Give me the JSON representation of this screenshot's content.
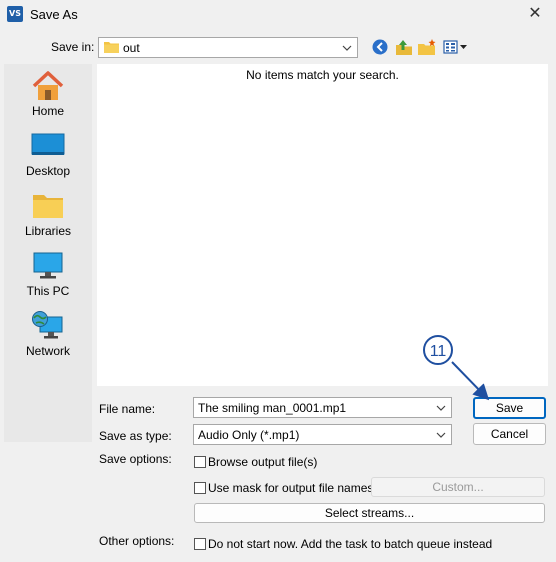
{
  "window": {
    "icon_text": "VS",
    "title": "Save As",
    "close_glyph": "✕"
  },
  "save_in": {
    "label": "Save in:",
    "value": "out"
  },
  "toolbar": {
    "icons": [
      "back-icon",
      "up-folder-icon",
      "new-folder-icon",
      "view-menu-icon"
    ]
  },
  "places": [
    {
      "label": "Home",
      "icon": "home-icon"
    },
    {
      "label": "Desktop",
      "icon": "desktop-icon"
    },
    {
      "label": "Libraries",
      "icon": "libraries-icon"
    },
    {
      "label": "This PC",
      "icon": "this-pc-icon"
    },
    {
      "label": "Network",
      "icon": "network-icon"
    }
  ],
  "file_list": {
    "empty_message": "No items match your search."
  },
  "file_name": {
    "label": "File name:",
    "value": "The smiling man_0001.mp1"
  },
  "save_as_type": {
    "label": "Save as type:",
    "value": "Audio Only (*.mp1)"
  },
  "buttons": {
    "save": "Save",
    "cancel": "Cancel",
    "custom": "Custom...",
    "select_streams": "Select streams..."
  },
  "save_options": {
    "label": "Save options:",
    "browse_output": {
      "label": "Browse output file(s)",
      "checked": false
    },
    "use_mask": {
      "label": "Use mask for output file names",
      "checked": false
    }
  },
  "other_options": {
    "label": "Other options:",
    "do_not_start": {
      "label": "Do not start now. Add the task to batch queue instead",
      "checked": false
    }
  },
  "annotation": {
    "step_number": "11",
    "color": "#1f4fa0"
  },
  "colors": {
    "accent": "#0067c0",
    "window_bg": "#f0f0f0",
    "places_bg": "#e8e8e8"
  }
}
